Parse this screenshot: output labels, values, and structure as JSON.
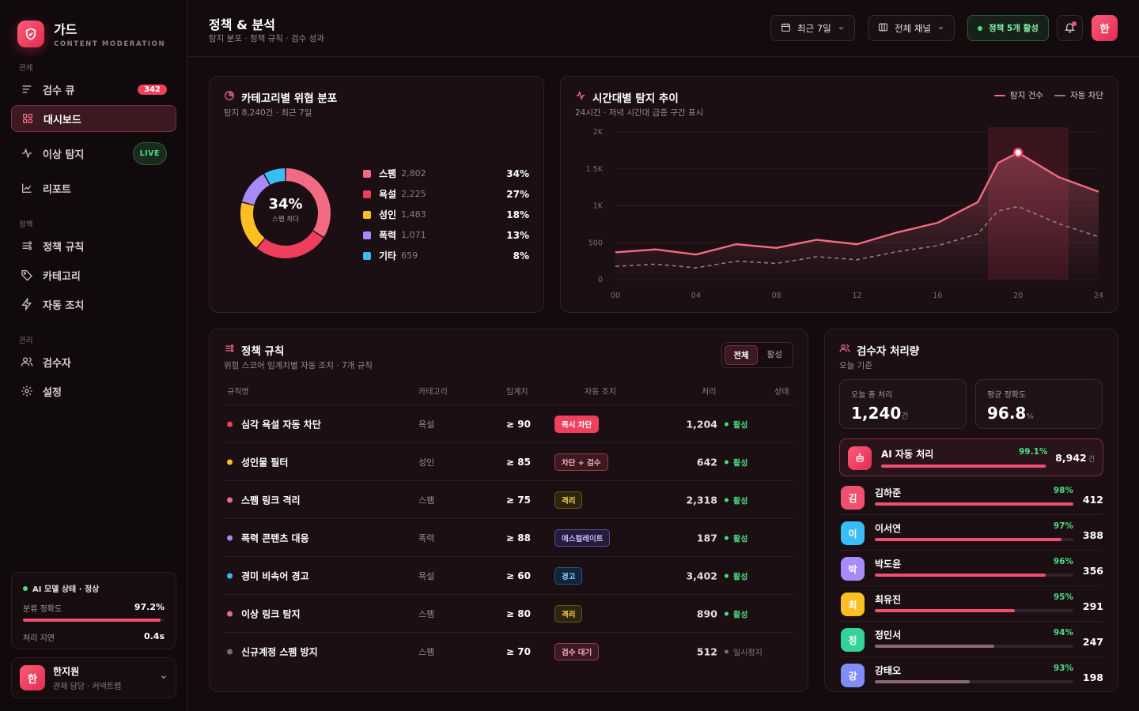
{
  "brand": {
    "name": "가드",
    "sub": "CONTENT MODERATION"
  },
  "sidebar": {
    "sections": [
      "관제",
      "정책",
      "관리"
    ],
    "items": [
      {
        "label": "검수 큐",
        "icon": "queue-icon",
        "badge": "342"
      },
      {
        "label": "대시보드",
        "icon": "grid-icon",
        "active": true
      },
      {
        "label": "이상 탐지",
        "icon": "pulse-icon",
        "badge": "LIVE"
      },
      {
        "label": "리포트",
        "icon": "chart-icon"
      },
      {
        "label": "정책 규칙",
        "icon": "rules-icon"
      },
      {
        "label": "카테고리",
        "icon": "tag-icon"
      },
      {
        "label": "자동 조치",
        "icon": "bolt-icon"
      },
      {
        "label": "검수자",
        "icon": "users-icon"
      },
      {
        "label": "설정",
        "icon": "gear-icon"
      }
    ],
    "ai_status": {
      "title": "AI 모델 상태 · 정상",
      "acc_label": "분류 정확도",
      "acc_value": "97.2%",
      "acc_fraction": 0.972,
      "lat_label": "처리 지연",
      "lat_value": "0.4s"
    },
    "user": {
      "initial": "한",
      "name": "한지원",
      "role": "관제 담당 · 커넥트랩"
    }
  },
  "header": {
    "title": "정책 & 분석",
    "subtitle": "탐지 분포 · 정책 규칙 · 검수 성과",
    "period": "최근 7일",
    "channel": "전체 채널",
    "policy_status": "정책 5개 활성",
    "avatar": "한"
  },
  "category": {
    "title": "카테고리별 위협 분포",
    "subtitle": "탐지 8,240건 · 최근 7일",
    "center_value": "34%",
    "center_label": "스팸 최다",
    "items": [
      {
        "name": "스팸",
        "count": "2,802",
        "pct": "34%",
        "color": "#f26b83"
      },
      {
        "name": "욕설",
        "count": "2,225",
        "pct": "27%",
        "color": "#ef3d5e"
      },
      {
        "name": "성인",
        "count": "1,483",
        "pct": "18%",
        "color": "#fbbf24"
      },
      {
        "name": "폭력",
        "count": "1,071",
        "pct": "13%",
        "color": "#a78bfa"
      },
      {
        "name": "기타",
        "count": "659",
        "pct": "8%",
        "color": "#38bdf8"
      }
    ]
  },
  "trend": {
    "title": "시간대별 탐지 추이",
    "subtitle": "24시간 · 저녁 시간대 급증 구간 표시",
    "legend": [
      "탐지 건수",
      "자동 차단"
    ]
  },
  "chart_data": {
    "type": "line",
    "x": [
      0,
      2,
      4,
      6,
      8,
      10,
      12,
      14,
      16,
      18,
      19,
      20,
      22,
      24
    ],
    "series": [
      {
        "name": "탐지 건수",
        "values": [
          370,
          410,
          340,
          480,
          430,
          540,
          480,
          640,
          770,
          1050,
          1580,
          1720,
          1390,
          1190
        ]
      },
      {
        "name": "자동 차단",
        "values": [
          180,
          210,
          160,
          250,
          220,
          310,
          270,
          380,
          460,
          620,
          930,
          990,
          760,
          580
        ]
      }
    ],
    "xticks": [
      "00",
      "04",
      "08",
      "12",
      "16",
      "20",
      "24"
    ],
    "yticks": [
      "0",
      "500",
      "1K",
      "1.5K",
      "2K"
    ],
    "ylim": [
      0,
      2000
    ],
    "xlim": [
      0,
      24
    ],
    "highlight_band": [
      18.5,
      22.5
    ]
  },
  "rules": {
    "title": "정책 규칙",
    "subtitle": "위험 스코어 임계치별 자동 조치 · 7개 규칙",
    "filters": [
      "전체",
      "활성"
    ],
    "columns": [
      "규칙명",
      "카테고리",
      "임계치",
      "자동 조치",
      "처리",
      "상태"
    ],
    "rows": [
      {
        "dot": "#f0405e",
        "name": "심각 욕설 자동 차단",
        "cat": "욕설",
        "thr": "≥ 90",
        "action": "즉시 차단",
        "act_style": "red",
        "proc": "1,204",
        "status": "활성"
      },
      {
        "dot": "#fbbf24",
        "name": "성인물 필터",
        "cat": "성인",
        "thr": "≥ 85",
        "action": "차단 + 검수",
        "act_style": "pink",
        "proc": "642",
        "status": "활성"
      },
      {
        "dot": "#f26b83",
        "name": "스팸 링크 격리",
        "cat": "스팸",
        "thr": "≥ 75",
        "action": "격리",
        "act_style": "amber",
        "proc": "2,318",
        "status": "활성"
      },
      {
        "dot": "#a78bfa",
        "name": "폭력 콘텐츠 대응",
        "cat": "폭력",
        "thr": "≥ 88",
        "action": "에스컬레이트",
        "act_style": "purple",
        "proc": "187",
        "status": "활성"
      },
      {
        "dot": "#38bdf8",
        "name": "경미 비속어 경고",
        "cat": "욕설",
        "thr": "≥ 60",
        "action": "경고",
        "act_style": "blue",
        "proc": "3,402",
        "status": "활성"
      },
      {
        "dot": "#f26b83",
        "name": "이상 링크 탐지",
        "cat": "스팸",
        "thr": "≥ 80",
        "action": "격리",
        "act_style": "amber",
        "proc": "890",
        "status": "활성"
      },
      {
        "dot": "#7d6b72",
        "name": "신규계정 스팸 방지",
        "cat": "스팸",
        "thr": "≥ 70",
        "action": "검수 대기",
        "act_style": "pink",
        "proc": "512",
        "status": "일시정지"
      }
    ]
  },
  "reviewers": {
    "title": "검수자 처리량",
    "subtitle": "오늘 기준",
    "total_label": "오늘 총 처리",
    "total_value": "1,240",
    "total_unit": "건",
    "acc_label": "평균 정확도",
    "acc_value": "96.8",
    "acc_unit": "%",
    "ai": {
      "label": "AI 자동 처리",
      "pct": "99.1%",
      "fraction": 0.991,
      "count": "8,942",
      "unit": "건"
    },
    "list": [
      {
        "initial": "김",
        "name": "김하준",
        "pct": "98%",
        "fraction": 1.0,
        "count": "412",
        "color": "#f0506e",
        "bar": "#f0506e"
      },
      {
        "initial": "이",
        "name": "이서연",
        "pct": "97%",
        "fraction": 0.94,
        "count": "388",
        "color": "#38bdf8",
        "bar": "#f0506e"
      },
      {
        "initial": "박",
        "name": "박도윤",
        "pct": "96%",
        "fraction": 0.86,
        "count": "356",
        "color": "#a78bfa",
        "bar": "#f0506e"
      },
      {
        "initial": "최",
        "name": "최유진",
        "pct": "95%",
        "fraction": 0.705,
        "count": "291",
        "color": "#fbbf24",
        "bar": "#f0506e"
      },
      {
        "initial": "정",
        "name": "정민서",
        "pct": "94%",
        "fraction": 0.6,
        "count": "247",
        "color": "#34d399",
        "bar": "#8a6a74"
      },
      {
        "initial": "강",
        "name": "강태오",
        "pct": "93%",
        "fraction": 0.48,
        "count": "198",
        "color": "#818cf8",
        "bar": "#8a6a74"
      }
    ]
  }
}
